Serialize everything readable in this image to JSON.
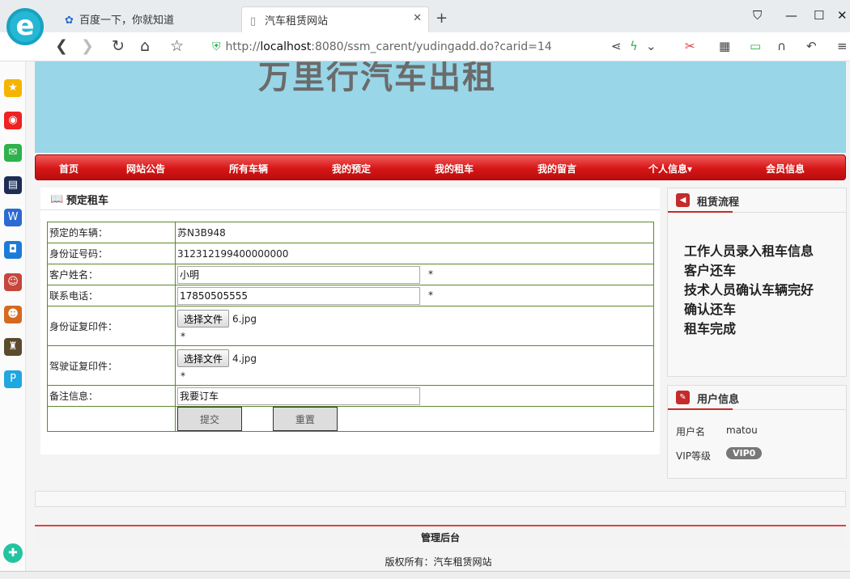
{
  "browser": {
    "tabs": [
      {
        "label": "百度一下，你就知道",
        "icon": "baidu-paw-icon"
      },
      {
        "label": "汽车租赁网站",
        "icon": "page-icon",
        "active": true
      }
    ],
    "url_scheme": "http://",
    "url_host": "localhost",
    "url_rest": ":8080/ssm_carent/yudingadd.do?carid=14"
  },
  "site": {
    "banner_title": "万里行汽车出租",
    "nav": [
      "首页",
      "网站公告",
      "所有车辆",
      "我的预定",
      "我的租车",
      "我的留言",
      "个人信息",
      "会员信息"
    ]
  },
  "form": {
    "section_title": "预定租车",
    "rows": {
      "vehicle_label": "预定的车辆：",
      "vehicle_value": "苏N3B948",
      "idnum_label": "身份证号码：",
      "idnum_value": "312312199400000000",
      "name_label": "客户姓名：",
      "name_value": "小明",
      "phone_label": "联系电话：",
      "phone_value": "17850505555",
      "idcopy_label": "身份证复印件：",
      "idcopy_file": "6.jpg",
      "license_label": "驾驶证复印件：",
      "license_file": "4.jpg",
      "note_label": "备注信息：",
      "note_value": "我要订车"
    },
    "required_mark": "*",
    "choose_file": "选择文件",
    "submit": "提交",
    "reset": "重置"
  },
  "rental_flow": {
    "title": "租赁流程",
    "steps": [
      "工作人员录入租车信息",
      "客户还车",
      "技术人员确认车辆完好",
      "确认还车",
      "租车完成"
    ]
  },
  "user_info": {
    "title": "用户信息",
    "username_label": "用户名",
    "username_value": "matou",
    "vip_label": "VIP等级",
    "vip_value": "VIP0"
  },
  "footer": {
    "admin": "管理后台",
    "copyright": "版权所有：汽车租赁网站"
  }
}
